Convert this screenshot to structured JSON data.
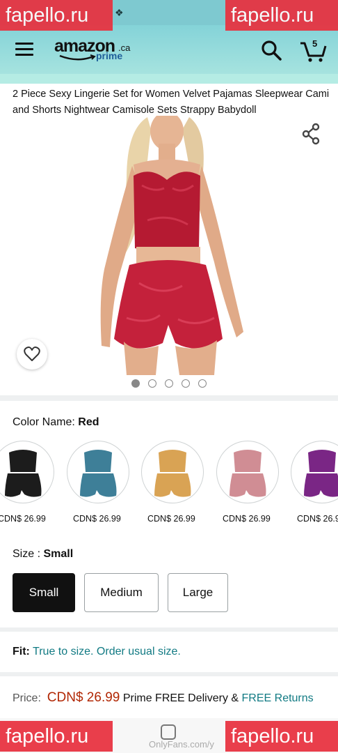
{
  "watermark": {
    "text": "fapello.ru"
  },
  "header": {
    "logo_main": "amazon",
    "logo_suffix": ".ca",
    "logo_sub": "prime",
    "cart_count": "5",
    "icons": [
      "menu-icon",
      "search-icon",
      "cart-icon"
    ]
  },
  "product": {
    "title": "2 Piece Sexy Lingerie Set for Women Velvet Pajamas Sleepwear Cami and Shorts Nightwear Camisole Sets Strappy Babydoll",
    "image_dots": 5,
    "active_image": 0
  },
  "color": {
    "label": "Color Name:",
    "selected": "Red",
    "variants": [
      {
        "hex": "#1c1c1c",
        "price": "CDN$ 26.99"
      },
      {
        "hex": "#3e7f98",
        "price": "CDN$ 26.99"
      },
      {
        "hex": "#d9a354",
        "price": "CDN$ 26.99"
      },
      {
        "hex": "#d08d94",
        "price": "CDN$ 26.99"
      },
      {
        "hex": "#7a2685",
        "price": "CDN$ 26.9"
      }
    ]
  },
  "size": {
    "label": "Size : ",
    "selected": "Small",
    "options": [
      "Small",
      "Medium",
      "Large"
    ]
  },
  "fit": {
    "label": "Fit:",
    "text": "True to size. Order usual size."
  },
  "price": {
    "label": "Price:",
    "amount": "CDN$ 26.99",
    "delivery": "Prime FREE Delivery & ",
    "returns": "FREE Returns"
  },
  "footer": {
    "caption": "OnlyFans.com/y"
  },
  "colors": {
    "status_bar": "#7ec9d0",
    "header": "#84d3d8",
    "teal_link": "#117a83",
    "price_red": "#b12704",
    "watermark": "#e8313f",
    "product_red": "#b51a32"
  }
}
